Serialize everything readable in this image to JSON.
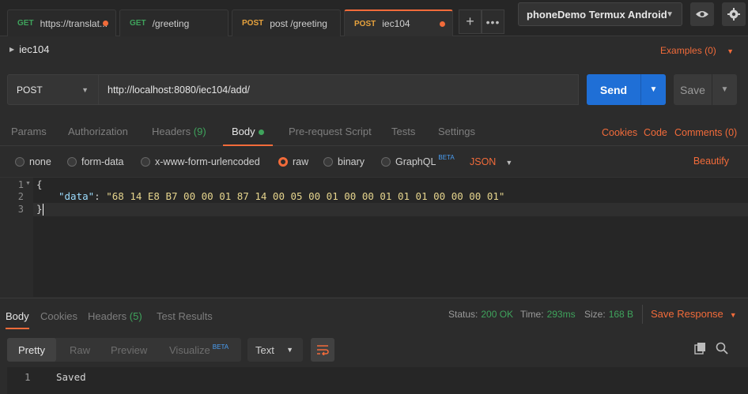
{
  "tabs": [
    {
      "method": "GET",
      "method_color": "#3fa35c",
      "title": "https://translat...",
      "unsaved": true
    },
    {
      "method": "GET",
      "method_color": "#3fa35c",
      "title": "/greeting",
      "unsaved": false
    },
    {
      "method": "POST",
      "method_color": "#e8a33d",
      "title": "post /greeting",
      "unsaved": false
    },
    {
      "method": "POST",
      "method_color": "#e8a33d",
      "title": "iec104",
      "unsaved": true,
      "active": true
    }
  ],
  "environment": {
    "selected": "phoneDemo Termux Android"
  },
  "request": {
    "name": "iec104",
    "examples_label": "Examples (0)",
    "method": "POST",
    "url": "http://localhost:8080/iec104/add/",
    "send_label": "Send",
    "save_label": "Save"
  },
  "request_tabs": {
    "params": "Params",
    "authorization": "Authorization",
    "headers": "Headers",
    "headers_count": "(9)",
    "body": "Body",
    "pre_request": "Pre-request Script",
    "tests": "Tests",
    "settings": "Settings",
    "cookies": "Cookies",
    "code": "Code",
    "comments": "Comments (0)"
  },
  "body_types": {
    "none": "none",
    "form_data": "form-data",
    "urlencoded": "x-www-form-urlencoded",
    "raw": "raw",
    "binary": "binary",
    "graphql": "GraphQL",
    "graphql_badge": "BETA",
    "selected": "raw",
    "format": "JSON",
    "beautify": "Beautify"
  },
  "editor": {
    "line_numbers": [
      "1",
      "2",
      "3"
    ],
    "line1": "{",
    "key": "\"data\"",
    "colon": ": ",
    "value": "\"68 14 E8 B7 00 00 01 87 14 00 05 00 01 00 00 01 01 01 00 00 00 01\"",
    "line3": "}"
  },
  "response": {
    "tabs": {
      "body": "Body",
      "cookies": "Cookies",
      "headers": "Headers",
      "headers_count": "(5)",
      "test_results": "Test Results"
    },
    "status_label": "Status:",
    "status_value": "200 OK",
    "time_label": "Time:",
    "time_value": "293ms",
    "size_label": "Size:",
    "size_value": "168 B",
    "save_response": "Save Response",
    "views": {
      "pretty": "Pretty",
      "raw": "Raw",
      "preview": "Preview",
      "visualize": "Visualize",
      "visualize_badge": "BETA"
    },
    "format": "Text",
    "line_number": "1",
    "body_text": "Saved"
  },
  "colors": {
    "accent": "#f26b3a",
    "send_button": "#1f6fd6",
    "success": "#3fa35c"
  }
}
